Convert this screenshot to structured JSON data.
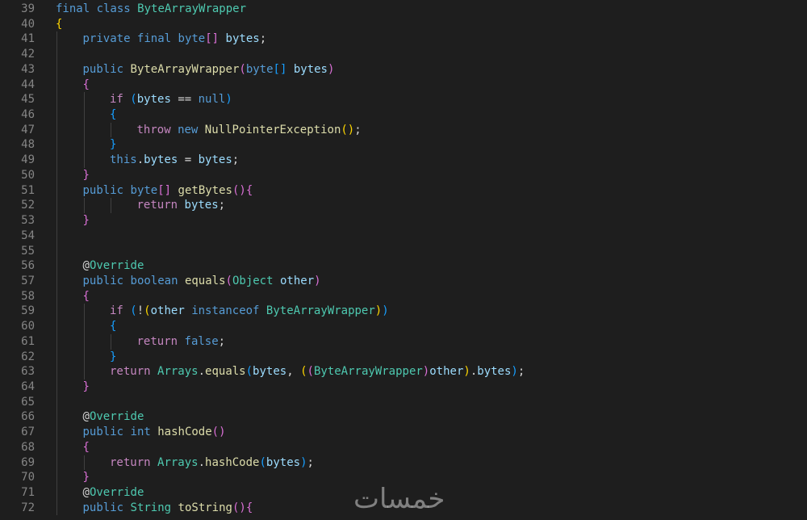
{
  "colors": {
    "background": "#1e1e1e",
    "line_number": "#858585",
    "keyword": "#569cd6",
    "control_keyword": "#c586c0",
    "type": "#4ec9b0",
    "function": "#dcdcaa",
    "variable": "#9cdcfe",
    "bracket_level_1": "#ffd700",
    "bracket_level_2": "#da70d6",
    "bracket_level_3": "#179fff",
    "plain": "#d4d4d4"
  },
  "watermark": "خمسات",
  "lines": [
    {
      "n": "39",
      "indent": 0,
      "tokens": [
        [
          "final class ",
          "kw"
        ],
        [
          "ByteArrayWrapper",
          "ty"
        ]
      ]
    },
    {
      "n": "40",
      "indent": 0,
      "tokens": [
        [
          "{",
          "b1"
        ]
      ]
    },
    {
      "n": "41",
      "indent": 1,
      "tokens": [
        [
          "private final ",
          "kw"
        ],
        [
          "byte",
          "kw"
        ],
        [
          "[]",
          "b2"
        ],
        [
          " ",
          "plain"
        ],
        [
          "bytes",
          "var"
        ],
        [
          ";",
          "plain"
        ]
      ]
    },
    {
      "n": "42",
      "indent": 1,
      "tokens": []
    },
    {
      "n": "43",
      "indent": 1,
      "tokens": [
        [
          "public ",
          "kw"
        ],
        [
          "ByteArrayWrapper",
          "fn"
        ],
        [
          "(",
          "b2"
        ],
        [
          "byte",
          "kw"
        ],
        [
          "[]",
          "b3"
        ],
        [
          " ",
          "plain"
        ],
        [
          "bytes",
          "var"
        ],
        [
          ")",
          "b2"
        ]
      ]
    },
    {
      "n": "44",
      "indent": 1,
      "tokens": [
        [
          "{",
          "b2"
        ]
      ]
    },
    {
      "n": "45",
      "indent": 2,
      "tokens": [
        [
          "if ",
          "ctl"
        ],
        [
          "(",
          "b3"
        ],
        [
          "bytes",
          "var"
        ],
        [
          " == ",
          "plain"
        ],
        [
          "null",
          "kw"
        ],
        [
          ")",
          "b3"
        ]
      ]
    },
    {
      "n": "46",
      "indent": 2,
      "tokens": [
        [
          "{",
          "b3"
        ]
      ]
    },
    {
      "n": "47",
      "indent": 3,
      "tokens": [
        [
          "throw ",
          "ctl"
        ],
        [
          "new ",
          "kw"
        ],
        [
          "NullPointerException",
          "fn"
        ],
        [
          "()",
          "b1"
        ],
        [
          ";",
          "plain"
        ]
      ]
    },
    {
      "n": "48",
      "indent": 2,
      "tokens": [
        [
          "}",
          "b3"
        ]
      ]
    },
    {
      "n": "49",
      "indent": 2,
      "tokens": [
        [
          "this",
          "kw"
        ],
        [
          ".",
          "plain"
        ],
        [
          "bytes",
          "var"
        ],
        [
          " = ",
          "plain"
        ],
        [
          "bytes",
          "var"
        ],
        [
          ";",
          "plain"
        ]
      ]
    },
    {
      "n": "50",
      "indent": 1,
      "tokens": [
        [
          "}",
          "b2"
        ]
      ]
    },
    {
      "n": "51",
      "indent": 1,
      "tokens": [
        [
          "public ",
          "kw"
        ],
        [
          "byte",
          "kw"
        ],
        [
          "[]",
          "b2"
        ],
        [
          " ",
          "plain"
        ],
        [
          "getBytes",
          "fn"
        ],
        [
          "()",
          "b2"
        ],
        [
          "{",
          "b2"
        ]
      ]
    },
    {
      "n": "52",
      "indent": 3,
      "tokens": [
        [
          "return ",
          "ctl"
        ],
        [
          "bytes",
          "var"
        ],
        [
          ";",
          "plain"
        ]
      ]
    },
    {
      "n": "53",
      "indent": 1,
      "tokens": [
        [
          "}",
          "b2"
        ]
      ]
    },
    {
      "n": "54",
      "indent": 1,
      "tokens": []
    },
    {
      "n": "55",
      "indent": 1,
      "tokens": []
    },
    {
      "n": "56",
      "indent": 1,
      "tokens": [
        [
          "@",
          "plain"
        ],
        [
          "Override",
          "ty"
        ]
      ]
    },
    {
      "n": "57",
      "indent": 1,
      "tokens": [
        [
          "public ",
          "kw"
        ],
        [
          "boolean ",
          "kw"
        ],
        [
          "equals",
          "fn"
        ],
        [
          "(",
          "b2"
        ],
        [
          "Object",
          "ty"
        ],
        [
          " ",
          "plain"
        ],
        [
          "other",
          "var"
        ],
        [
          ")",
          "b2"
        ]
      ]
    },
    {
      "n": "58",
      "indent": 1,
      "tokens": [
        [
          "{",
          "b2"
        ]
      ]
    },
    {
      "n": "59",
      "indent": 2,
      "tokens": [
        [
          "if ",
          "ctl"
        ],
        [
          "(",
          "b3"
        ],
        [
          "!",
          "plain"
        ],
        [
          "(",
          "b1"
        ],
        [
          "other",
          "var"
        ],
        [
          " instanceof ",
          "kw"
        ],
        [
          "ByteArrayWrapper",
          "ty"
        ],
        [
          ")",
          "b1"
        ],
        [
          ")",
          "b3"
        ]
      ]
    },
    {
      "n": "60",
      "indent": 2,
      "tokens": [
        [
          "{",
          "b3"
        ]
      ]
    },
    {
      "n": "61",
      "indent": 3,
      "tokens": [
        [
          "return ",
          "ctl"
        ],
        [
          "false",
          "kw"
        ],
        [
          ";",
          "plain"
        ]
      ]
    },
    {
      "n": "62",
      "indent": 2,
      "tokens": [
        [
          "}",
          "b3"
        ]
      ]
    },
    {
      "n": "63",
      "indent": 2,
      "tokens": [
        [
          "return ",
          "ctl"
        ],
        [
          "Arrays",
          "ty"
        ],
        [
          ".",
          "plain"
        ],
        [
          "equals",
          "fn"
        ],
        [
          "(",
          "b3"
        ],
        [
          "bytes",
          "var"
        ],
        [
          ", ",
          "plain"
        ],
        [
          "(",
          "b1"
        ],
        [
          "(",
          "b2"
        ],
        [
          "ByteArrayWrapper",
          "ty"
        ],
        [
          ")",
          "b2"
        ],
        [
          "other",
          "var"
        ],
        [
          ")",
          "b1"
        ],
        [
          ".",
          "plain"
        ],
        [
          "bytes",
          "var"
        ],
        [
          ")",
          "b3"
        ],
        [
          ";",
          "plain"
        ]
      ]
    },
    {
      "n": "64",
      "indent": 1,
      "tokens": [
        [
          "}",
          "b2"
        ]
      ]
    },
    {
      "n": "65",
      "indent": 1,
      "tokens": []
    },
    {
      "n": "66",
      "indent": 1,
      "tokens": [
        [
          "@",
          "plain"
        ],
        [
          "Override",
          "ty"
        ]
      ]
    },
    {
      "n": "67",
      "indent": 1,
      "tokens": [
        [
          "public ",
          "kw"
        ],
        [
          "int ",
          "kw"
        ],
        [
          "hashCode",
          "fn"
        ],
        [
          "()",
          "b2"
        ]
      ]
    },
    {
      "n": "68",
      "indent": 1,
      "tokens": [
        [
          "{",
          "b2"
        ]
      ]
    },
    {
      "n": "69",
      "indent": 2,
      "tokens": [
        [
          "return ",
          "ctl"
        ],
        [
          "Arrays",
          "ty"
        ],
        [
          ".",
          "plain"
        ],
        [
          "hashCode",
          "fn"
        ],
        [
          "(",
          "b3"
        ],
        [
          "bytes",
          "var"
        ],
        [
          ")",
          "b3"
        ],
        [
          ";",
          "plain"
        ]
      ]
    },
    {
      "n": "70",
      "indent": 1,
      "tokens": [
        [
          "}",
          "b2"
        ]
      ]
    },
    {
      "n": "71",
      "indent": 1,
      "tokens": [
        [
          "@",
          "plain"
        ],
        [
          "Override",
          "ty"
        ]
      ]
    },
    {
      "n": "72",
      "indent": 1,
      "tokens": [
        [
          "public ",
          "kw"
        ],
        [
          "String ",
          "ty"
        ],
        [
          "toString",
          "fn"
        ],
        [
          "()",
          "b2"
        ],
        [
          "{",
          "b2"
        ]
      ]
    }
  ]
}
